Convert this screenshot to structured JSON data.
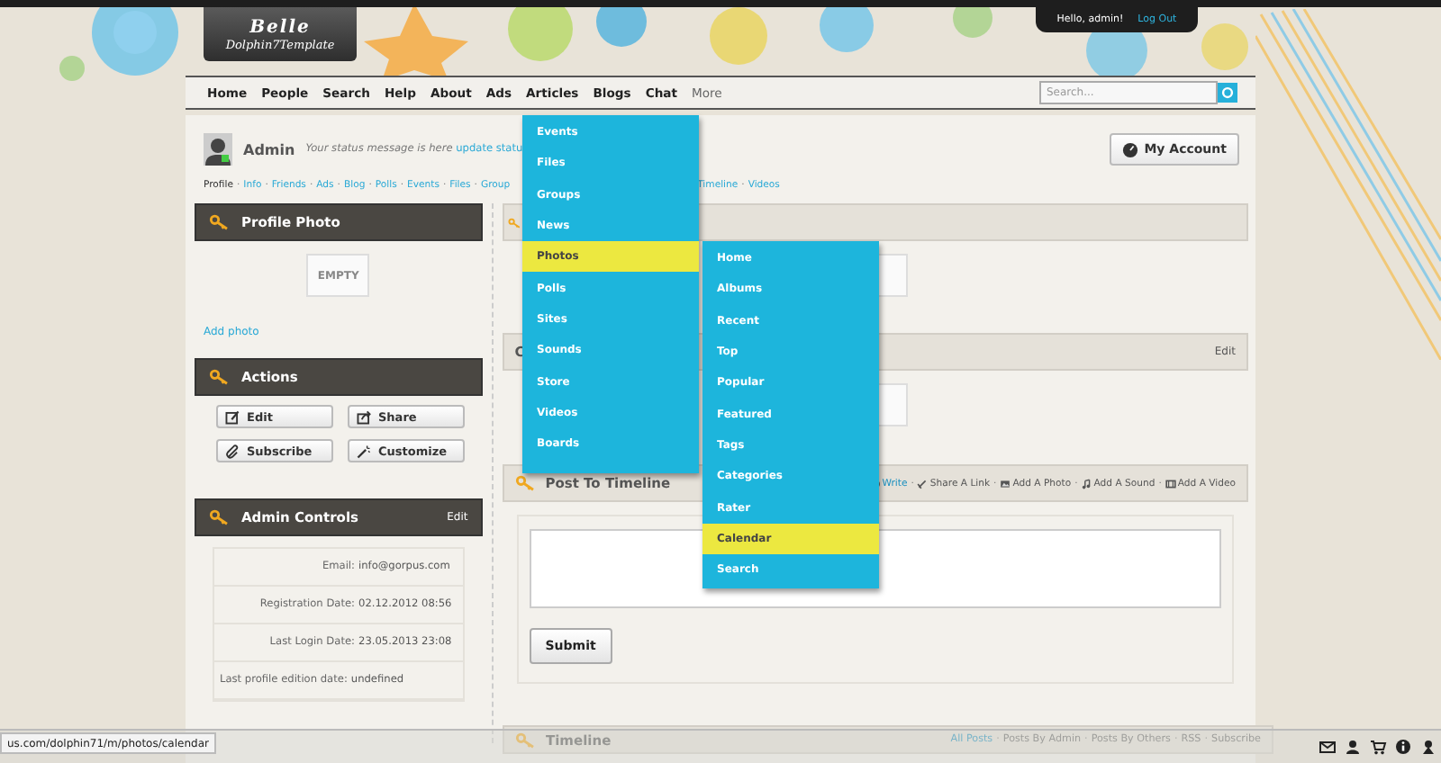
{
  "logo": {
    "title": "Belle",
    "subtitle": "Dolphin7Template"
  },
  "user_bar": {
    "greeting": "Hello, admin!",
    "logout": "Log Out"
  },
  "nav": [
    {
      "label": "Home",
      "selected": false
    },
    {
      "label": "People",
      "selected": false
    },
    {
      "label": "Search",
      "selected": false
    },
    {
      "label": "Help",
      "selected": false
    },
    {
      "label": "About",
      "selected": false
    },
    {
      "label": "Ads",
      "selected": false
    },
    {
      "label": "Articles",
      "selected": false
    },
    {
      "label": "Blogs",
      "selected": false
    },
    {
      "label": "Chat",
      "selected": false
    },
    {
      "label": "More",
      "selected": true
    }
  ],
  "search": {
    "placeholder": "Search..."
  },
  "profile": {
    "name": "Admin",
    "status": "Your status message is here",
    "status_link": "update statu",
    "account_button": "My Account"
  },
  "profile_links": [
    {
      "label": "Profile",
      "selected": true
    },
    {
      "label": "Info",
      "selected": false,
      "separator": "·"
    },
    {
      "label": "Friends",
      "selected": false,
      "separator": "·"
    },
    {
      "label": "Ads",
      "selected": false,
      "separator": "·"
    },
    {
      "label": "Blog",
      "selected": false,
      "separator": "·"
    },
    {
      "label": "Polls",
      "selected": false,
      "separator": "·"
    },
    {
      "label": "Events",
      "selected": false,
      "separator": "·"
    },
    {
      "label": "Files",
      "selected": false,
      "separator": "·"
    },
    {
      "label": "Group",
      "selected": false,
      "separator": "·",
      "cut": true
    },
    {
      "label": "Timeline",
      "selected": false
    },
    {
      "label": "Videos",
      "selected": false,
      "separator": "·"
    }
  ],
  "profile_photo": {
    "title": "Profile Photo",
    "empty": "EMPTY",
    "link": "Add photo"
  },
  "actions": {
    "title": "Actions",
    "buttons": [
      "Edit",
      "Share",
      "Subscribe",
      "Customize"
    ]
  },
  "admin_controls": {
    "title": "Admin Controls",
    "edit": "Edit",
    "rows": [
      {
        "label": "Email:",
        "value": "info@gorpus.com"
      },
      {
        "label": "Registration Date:",
        "value": "02.12.2012 08:56"
      },
      {
        "label": "Last Login Date:",
        "value": "23.05.2013 23:08"
      },
      {
        "label": "Last profile edition date:",
        "value": "undefined"
      }
    ]
  },
  "rss": {
    "title": "C",
    "edit": "Edit"
  },
  "post": {
    "title": "Post To Timeline",
    "links": [
      {
        "label": "Write",
        "selected": true
      },
      {
        "label": "Share A Link",
        "selected": false,
        "separator": "·"
      },
      {
        "label": "Add A Photo",
        "selected": false,
        "separator": "·"
      },
      {
        "label": "Add A Sound",
        "selected": false,
        "separator": "·"
      },
      {
        "label": "Add A Video",
        "selected": false,
        "separator": "·"
      }
    ],
    "submit": "Submit"
  },
  "timeline": {
    "title": "Timeline",
    "links": [
      {
        "label": "All Posts",
        "selected": true
      },
      {
        "label": "Posts By Admin",
        "selected": false,
        "separator": "·"
      },
      {
        "label": "Posts By Others",
        "selected": false,
        "separator": "·"
      },
      {
        "label": "RSS",
        "selected": false,
        "separator": "·"
      },
      {
        "label": "Subscribe",
        "selected": false,
        "separator": "·"
      }
    ]
  },
  "more_menu": [
    {
      "label": "Events",
      "selected": false
    },
    {
      "label": "Files",
      "selected": false
    },
    {
      "label": "Groups",
      "selected": false
    },
    {
      "label": "News",
      "selected": false
    },
    {
      "label": "Photos",
      "selected": true
    },
    {
      "label": "Polls",
      "selected": false
    },
    {
      "label": "Sites",
      "selected": false
    },
    {
      "label": "Sounds",
      "selected": false
    },
    {
      "label": "Store",
      "selected": false
    },
    {
      "label": "Videos",
      "selected": false
    },
    {
      "label": "Boards",
      "selected": false
    }
  ],
  "photos_menu": [
    {
      "label": "Home",
      "selected": false
    },
    {
      "label": "Albums",
      "selected": false
    },
    {
      "label": "Recent",
      "selected": false
    },
    {
      "label": "Top",
      "selected": false
    },
    {
      "label": "Popular",
      "selected": false
    },
    {
      "label": "Featured",
      "selected": false
    },
    {
      "label": "Tags",
      "selected": false
    },
    {
      "label": "Categories",
      "selected": false
    },
    {
      "label": "Rater",
      "selected": false
    },
    {
      "label": "Calendar",
      "selected": true
    },
    {
      "label": "Search",
      "selected": false
    }
  ],
  "status_url": "us.com/dolphin71/m/photos/calendar"
}
